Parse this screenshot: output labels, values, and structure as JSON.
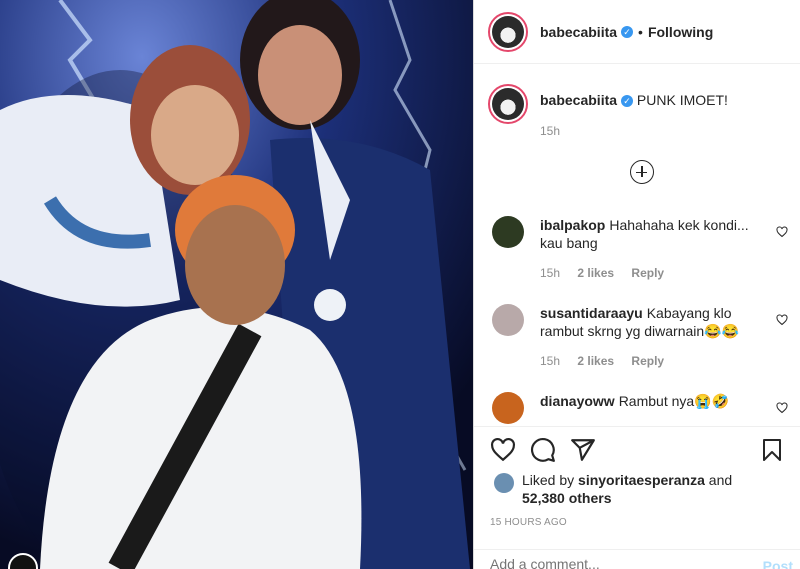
{
  "header": {
    "username": "babecabiita",
    "separator": "•",
    "follow_status": "Following"
  },
  "caption": {
    "username": "babecabiita",
    "text": "PUNK IMOET!",
    "time": "15h"
  },
  "comments": [
    {
      "username": "ibalpakop",
      "text": "Hahahaha kek kondi... kau bang",
      "time": "15h",
      "likes": "2 likes",
      "reply": "Reply",
      "avatar_color": "#2d3a22"
    },
    {
      "username": "susantidaraayu",
      "text": "Kabayang klo rambut skrng yg diwarnain😂😂",
      "time": "15h",
      "likes": "2 likes",
      "reply": "Reply",
      "avatar_color": "#b8a9a9"
    },
    {
      "username": "dianayoww",
      "text": "Rambut nya😭🤣",
      "avatar_color": "#c8641e"
    }
  ],
  "likes": {
    "prefix": "Liked by",
    "user": "sinyoritaesperanza",
    "and": "and",
    "others": "52,380 others"
  },
  "post_date": "15 HOURS AGO",
  "add_comment": {
    "placeholder": "Add a comment...",
    "post_label": "Post"
  },
  "colors": {
    "verified": "#3897f0",
    "post_button": "#b2dffc",
    "avatar_ring": "#e4476b"
  },
  "icons": [
    "verified-icon",
    "load-more-icon",
    "heart-icon",
    "comment-icon",
    "share-icon",
    "bookmark-icon"
  ]
}
